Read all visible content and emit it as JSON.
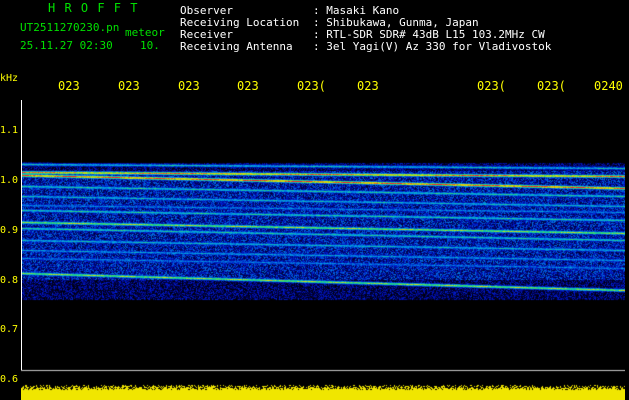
{
  "header": {
    "title": "H R O F F T",
    "filename": "UT2511270230.pn",
    "datetime": "25.11.27 02:30",
    "mode": "meteor",
    "interval": "10."
  },
  "info": {
    "rows": [
      {
        "label": "Observer",
        "value": ": Masaki Kano"
      },
      {
        "label": "Receiving Location",
        "value": ": Shibukawa, Gunma, Japan"
      },
      {
        "label": "Receiver",
        "value": ": RTL-SDR SDR# 43dB L15 103.2MHz CW"
      },
      {
        "label": "Receiving Antenna",
        "value": ": 3el Yagi(V) Az 330 for Vladivostok"
      }
    ]
  },
  "axis": {
    "unit": "kHz",
    "yticks": [
      "1.1",
      "1.0",
      "0.9",
      "0.8",
      "0.7",
      "0.6"
    ],
    "xticks": [
      "023",
      "023",
      "023",
      "023",
      "023(",
      "023",
      "023(",
      "023(",
      "0240"
    ]
  },
  "colors": {
    "background": "#000000",
    "text_info": "#ffffff",
    "text_title": "#00e000",
    "tick": "#ffff00"
  }
}
